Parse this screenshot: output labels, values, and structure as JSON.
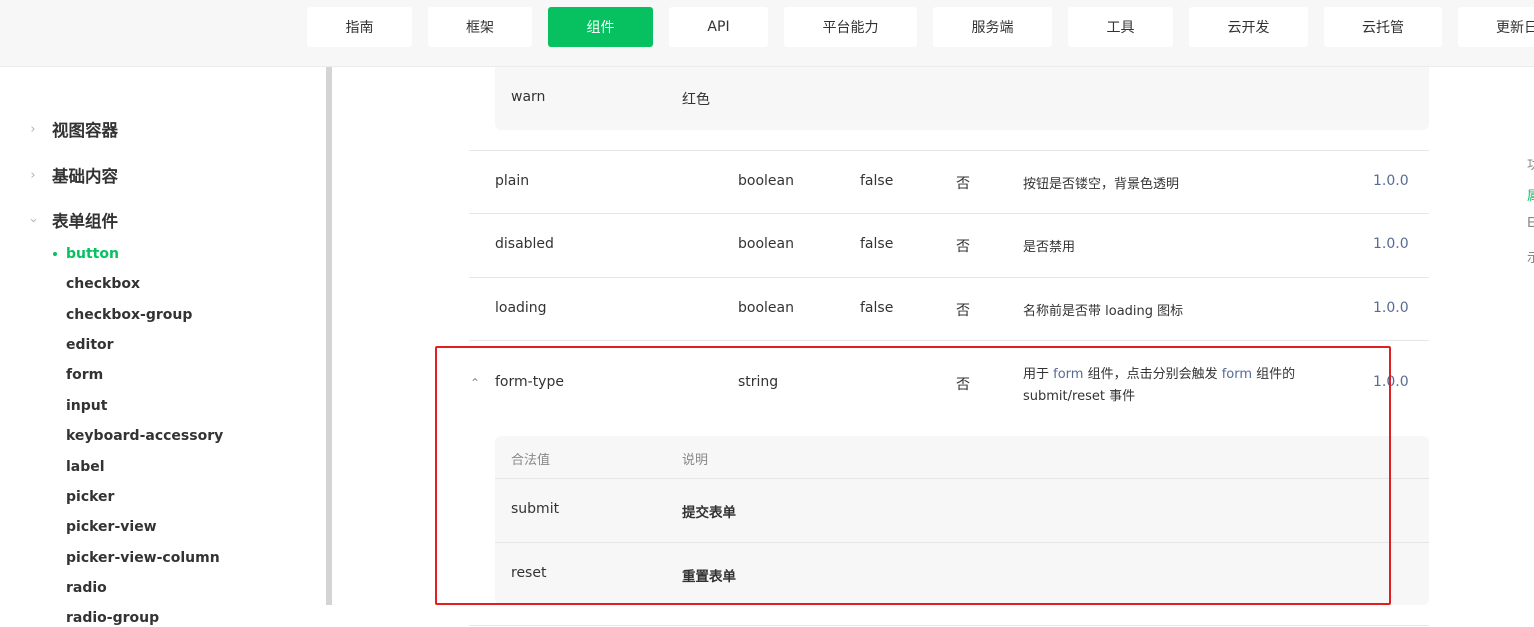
{
  "nav": {
    "items": [
      "指南",
      "框架",
      "组件",
      "API",
      "平台能力",
      "服务端",
      "工具",
      "云开发",
      "云托管",
      "更新日志"
    ],
    "active_index": 2
  },
  "sidebar": {
    "categories": [
      "视图容器",
      "基础内容",
      "表单组件"
    ],
    "items": [
      "button",
      "checkbox",
      "checkbox-group",
      "editor",
      "form",
      "input",
      "keyboard-accessory",
      "label",
      "picker",
      "picker-view",
      "picker-view-column",
      "radio",
      "radio-group"
    ],
    "active_item": "button"
  },
  "table": {
    "warn_row": {
      "value": "warn",
      "desc": "红色"
    },
    "rows": [
      {
        "name": "plain",
        "type": "boolean",
        "default": "false",
        "required": "否",
        "desc": "按钮是否镂空，背景色透明",
        "version": "1.0.0"
      },
      {
        "name": "disabled",
        "type": "boolean",
        "default": "false",
        "required": "否",
        "desc": "是否禁用",
        "version": "1.0.0"
      },
      {
        "name": "loading",
        "type": "boolean",
        "default": "false",
        "required": "否",
        "desc": "名称前是否带 loading 图标",
        "version": "1.0.0"
      }
    ],
    "form_type": {
      "name": "form-type",
      "type": "string",
      "required": "否",
      "desc_prefix": "用于 ",
      "desc_link1": "form",
      "desc_mid": " 组件，点击分别会触发 ",
      "desc_link2": "form",
      "desc_suffix": " 组件的",
      "desc_line2": "submit/reset 事件",
      "version": "1.0.0",
      "sub_headers": {
        "value": "合法值",
        "desc": "说明"
      },
      "sub_rows": [
        {
          "value": "submit",
          "desc": "提交表单"
        },
        {
          "value": "reset",
          "desc": "重置表单"
        }
      ]
    }
  },
  "toc": [
    "功",
    "属",
    "E",
    "示"
  ],
  "colors": {
    "accent": "#07c160",
    "link": "#576b95",
    "highlight": "#e02020"
  }
}
